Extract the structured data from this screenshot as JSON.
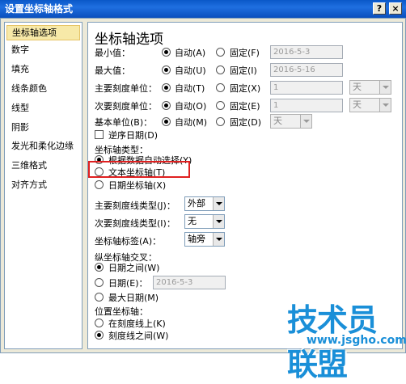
{
  "dialog": {
    "title": "设置坐标轴格式",
    "help_label": "?",
    "close_label": "×"
  },
  "sidebar": {
    "items": [
      {
        "label": "坐标轴选项"
      },
      {
        "label": "数字"
      },
      {
        "label": "填充"
      },
      {
        "label": "线条颜色"
      },
      {
        "label": "线型"
      },
      {
        "label": "阴影"
      },
      {
        "label": "发光和柔化边缘"
      },
      {
        "label": "三维格式"
      },
      {
        "label": "对齐方式"
      }
    ]
  },
  "panel": {
    "heading": "坐标轴选项",
    "rows": [
      {
        "label": "最小值：",
        "auto": "自动(A)",
        "fixed": "固定(F)",
        "value": "2016-5-3"
      },
      {
        "label": "最大值：",
        "auto": "自动(U)",
        "fixed": "固定(I)",
        "value": "2016-5-16"
      },
      {
        "label": "主要刻度单位：",
        "auto": "自动(T)",
        "fixed": "固定(X)",
        "value": "1",
        "unit": "天"
      },
      {
        "label": "次要刻度单位：",
        "auto": "自动(O)",
        "fixed": "固定(E)",
        "value": "1",
        "unit": "天"
      },
      {
        "label": "基本单位(B)：",
        "auto": "自动(M)",
        "fixed": "固定(D)",
        "unit": "天"
      }
    ],
    "reverse_dates": "逆序日期(D)",
    "axis_type": {
      "label": "坐标轴类型：",
      "options": [
        "根据数据自动选择(Y)",
        "文本坐标轴(T)",
        "日期坐标轴(X)"
      ]
    },
    "major_tick_type": {
      "label": "主要刻度线类型(J)：",
      "value": "外部"
    },
    "minor_tick_type": {
      "label": "次要刻度线类型(I)：",
      "value": "无"
    },
    "axis_labels": {
      "label": "坐标轴标签(A)：",
      "value": "轴旁"
    },
    "cross": {
      "label": "纵坐标轴交叉：",
      "between_dates": "日期之间(W)",
      "date": "日期(E)：",
      "date_value": "2016-5-3",
      "max_date": "最大日期(M)"
    },
    "position": {
      "label": "位置坐标轴：",
      "on_ticks": "在刻度线上(K)",
      "between_ticks": "刻度线之间(W)"
    }
  },
  "watermark": {
    "text": "技术员联盟",
    "url": "www.jsgho.com"
  },
  "colors": {
    "title_bar": "#0a58c8",
    "highlight": "#e02020",
    "watermark": "#1a8fd8"
  }
}
